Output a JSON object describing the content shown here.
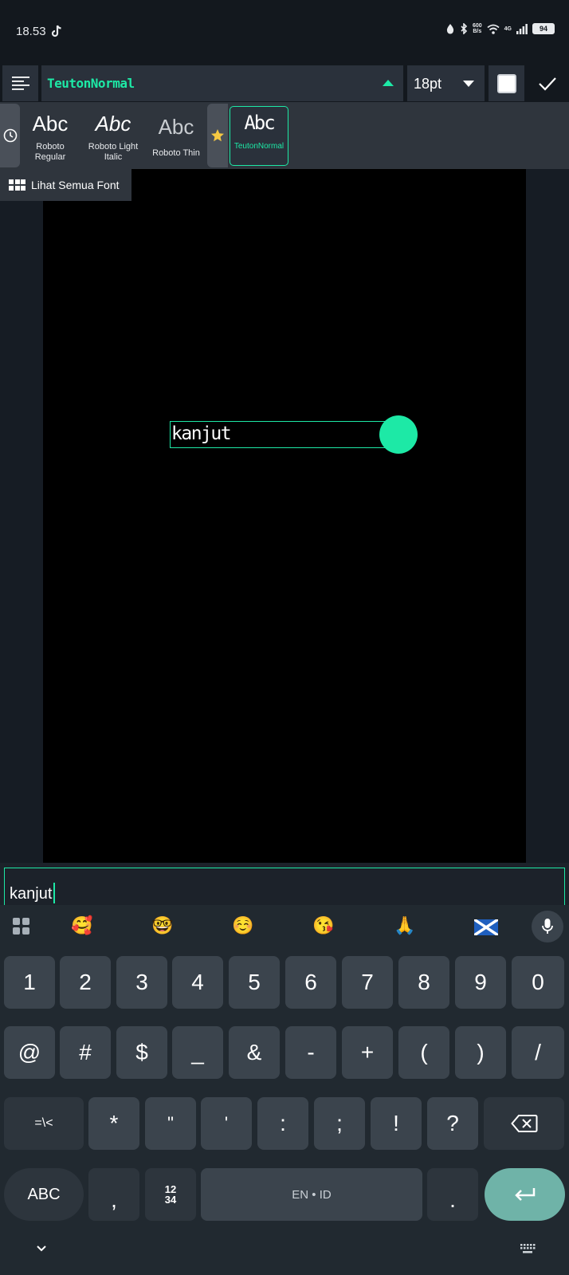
{
  "status_bar": {
    "time": "18.53",
    "net_speed_top": "600",
    "net_speed_bottom": "B/s",
    "network_type": "4G",
    "battery": "94"
  },
  "toolbar": {
    "font_name": "TeutonNormal",
    "font_size": "18pt",
    "text_color": "#ffffff"
  },
  "font_options": [
    {
      "sample": "Abc",
      "name": "Roboto Regular"
    },
    {
      "sample": "Abc",
      "name": "Roboto Light Italic"
    },
    {
      "sample": "Abc",
      "name": "Roboto Thin"
    },
    {
      "sample": "Abc",
      "name": "TeutonNormal"
    }
  ],
  "all_fonts_label": "Lihat Semua Font",
  "canvas": {
    "text": "kanjut",
    "background": "#000000",
    "accent": "#1de9a6"
  },
  "input": {
    "value": "kanjut"
  },
  "keyboard": {
    "suggestions": [
      "🥰",
      "🤓",
      "☺️",
      "😘",
      "🙏",
      "🏴"
    ],
    "row_numbers": [
      "1",
      "2",
      "3",
      "4",
      "5",
      "6",
      "7",
      "8",
      "9",
      "0"
    ],
    "row_symbols1": [
      "@",
      "#",
      "$",
      "_",
      "&",
      "-",
      "+",
      "(",
      ")",
      "/"
    ],
    "row_symbols2_toggle": "=\\<",
    "row_symbols2": [
      "*",
      "\"",
      "'",
      ":",
      ";",
      "!",
      "?"
    ],
    "abc_label": "ABC",
    "comma": ",",
    "numpad_top": "12",
    "numpad_bottom": "34",
    "space_label": "EN • ID",
    "period": "."
  }
}
